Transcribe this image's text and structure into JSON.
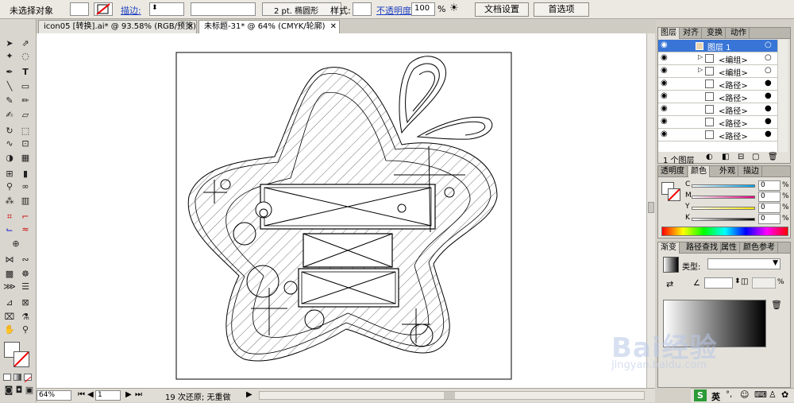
{
  "control_bar": {
    "selection_status": "未选择对象",
    "stroke_label": "描边:",
    "stroke_profile": "2 pt. 椭圆形",
    "style_label": "样式:",
    "opacity_label": "不透明度:",
    "opacity_value": "100",
    "opacity_unit": "%",
    "doc_setup_button": "文档设置",
    "preferences_button": "首选项"
  },
  "doc_tabs": [
    {
      "label": "icon05 [转换].ai* @ 93.58% (RGB/预览)"
    },
    {
      "label": "未标题-31* @ 64% (CMYK/轮廓)"
    }
  ],
  "layers_panel": {
    "tabs": [
      "图层",
      "对齐",
      "变换",
      "动作"
    ],
    "rows": [
      {
        "label": "图层 1"
      },
      {
        "label": "<编组>"
      },
      {
        "label": "<编组>"
      },
      {
        "label": "<路径>"
      },
      {
        "label": "<路径>"
      },
      {
        "label": "<路径>"
      },
      {
        "label": "<路径>"
      },
      {
        "label": "<路径>"
      }
    ],
    "footer": "1 个图层"
  },
  "color_panel": {
    "tabs": [
      "透明度",
      "颜色",
      "外观",
      "描边"
    ],
    "channels": [
      {
        "name": "C",
        "value": "0",
        "unit": "%",
        "color": "#00a0e8"
      },
      {
        "name": "M",
        "value": "0",
        "unit": "%",
        "color": "#e6007e"
      },
      {
        "name": "Y",
        "value": "0",
        "unit": "%",
        "color": "#ffe600"
      },
      {
        "name": "K",
        "value": "0",
        "unit": "%",
        "color": "#000000"
      }
    ]
  },
  "gradient_panel": {
    "tabs": [
      "渐变",
      "路径查找",
      "属性",
      "颜色参考"
    ],
    "type_label": "类型:",
    "percent_unit": "%"
  },
  "status_bar": {
    "zoom": "64%",
    "artboard": "1",
    "undo_status": "19 次还原; 无重做"
  },
  "watermark": {
    "brand": "Bai经验",
    "url": "jingyan.baidu.com"
  },
  "ime": {
    "lang": "英"
  }
}
